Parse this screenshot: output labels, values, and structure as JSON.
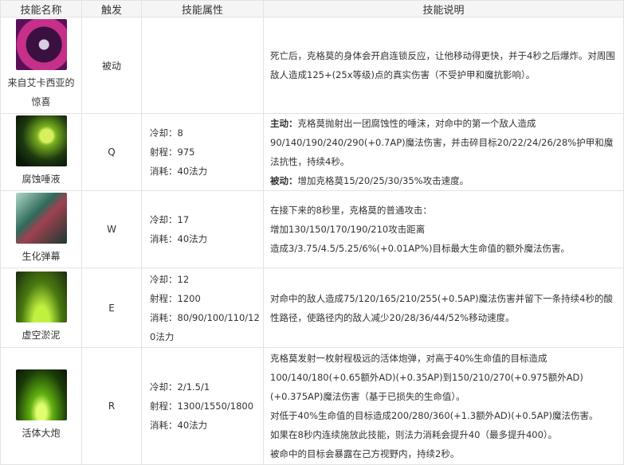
{
  "headers": [
    "技能名称",
    "触发",
    "技能属性",
    "技能说明"
  ],
  "rows": [
    {
      "name": "来自艾卡西亚的惊喜",
      "icon": "passive-skill-icon",
      "trigger": "被动",
      "attrs": [],
      "desc": [
        "死亡后，克格莫的身体会开启连锁反应，让他移动得更快，并于4秒之后爆炸。对周围敌人造成125+(25x等级)点的真实伤害（不受护甲和魔抗影响）。"
      ]
    },
    {
      "name": "腐蚀唾液",
      "icon": "q-skill-icon",
      "trigger": "Q",
      "attrs": [
        "冷却：8",
        "射程：975",
        "消耗：40法力"
      ],
      "desc_active_label": "主动：",
      "desc_active": "克格莫抛射出一团腐蚀性的唾沫，对命中的第一个敌人造成90/140/190/240/290(+0.7AP)魔法伤害，并击碎目标20/22/24/26/28%护甲和魔法抗性，持续4秒。",
      "desc_passive_label": "被动：",
      "desc_passive": "增加克格莫15/20/25/30/35%攻击速度。"
    },
    {
      "name": "生化弹幕",
      "icon": "w-skill-icon",
      "trigger": "W",
      "attrs": [
        "冷却：17",
        "消耗：40法力"
      ],
      "desc": [
        "在接下来的8秒里，克格莫的普通攻击：",
        "增加130/150/170/190/210攻击距离",
        "造成3/3.75/4.5/5.25/6%(+0.01AP%)目标最大生命值的额外魔法伤害。"
      ]
    },
    {
      "name": "虚空淤泥",
      "icon": "e-skill-icon",
      "trigger": "E",
      "attrs": [
        "冷却：12",
        "射程：1200",
        "消耗：80/90/100/110/120法力"
      ],
      "desc": [
        "对命中的敌人造成75/120/165/210/255(+0.5AP)魔法伤害并留下一条持续4秒的酸性路径，使路径内的敌人减少20/28/36/44/52%移动速度。"
      ]
    },
    {
      "name": "活体大炮",
      "icon": "r-skill-icon",
      "trigger": "R",
      "attrs": [
        "冷却：2/1.5/1",
        "射程：1300/1550/1800",
        "消耗：40法力"
      ],
      "desc": [
        "克格莫发射一枚射程极远的活体炮弹，对高于40%生命值的目标造成100/140/180(+0.65额外AD)(+0.35AP)到150/210/270(+0.975额外AD)(+0.375AP)魔法伤害（基于已损失的生命值）。",
        "对低于40%生命值的目标造成200/280/360(+1.3额外AD)(+0.5AP)魔法伤害。",
        "如果在8秒内连续施放此技能，则法力消耗会提升40（最多提升400）。",
        "被命中的目标会暴露在己方视野内，持续2秒。"
      ]
    }
  ]
}
